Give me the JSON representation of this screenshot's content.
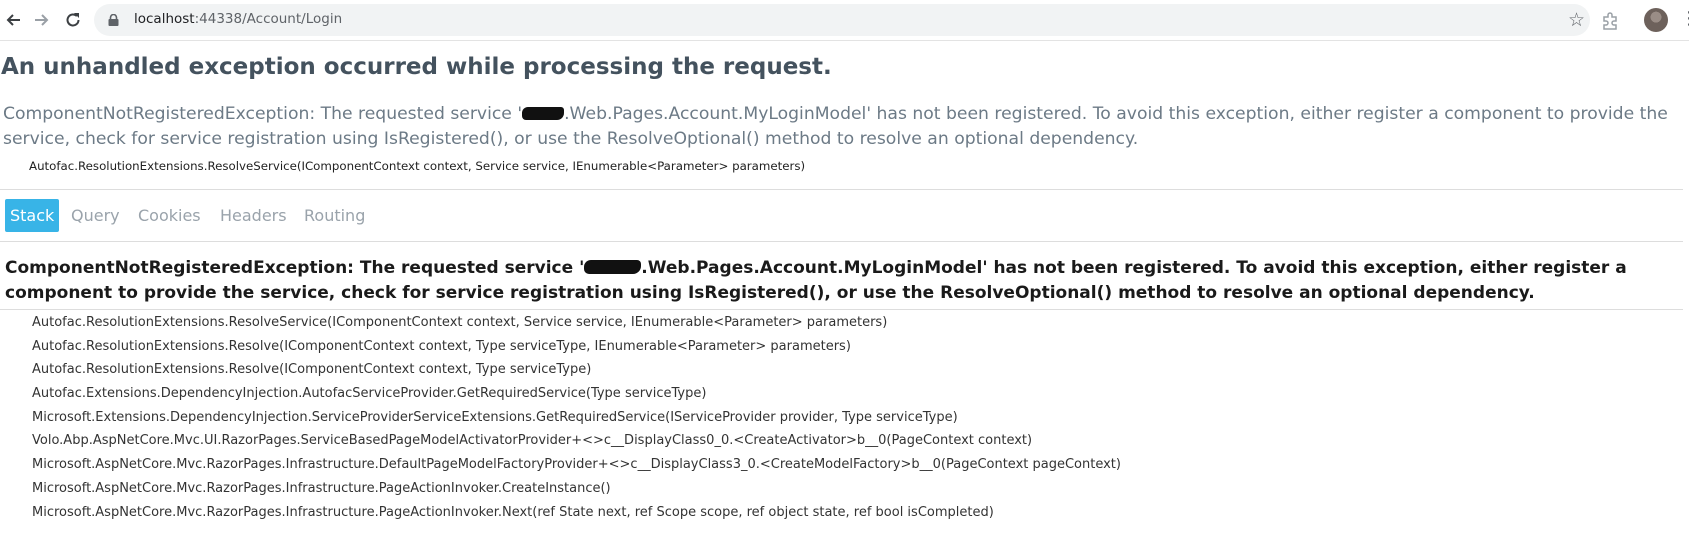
{
  "browser": {
    "url_host": "localhost",
    "url_rest": ":44338/Account/Login",
    "back_icon": "arrow-left-icon",
    "forward_icon": "arrow-right-icon",
    "reload_icon": "reload-icon",
    "star_icon": "star-icon"
  },
  "error": {
    "title": "An unhandled exception occurred while processing the request.",
    "summary_before": "ComponentNotRegisteredException: The requested service '",
    "summary_after": ".Web.Pages.Account.MyLoginModel' has not been registered. To avoid this exception, either register a component to provide the service, check for service registration using IsRegistered(), or use the ResolveOptional() method to resolve an optional dependency.",
    "location": "Autofac.ResolutionExtensions.ResolveService(IComponentContext context, Service service, IEnumerable<Parameter> parameters)"
  },
  "tabs": [
    {
      "label": "Stack",
      "selected": true
    },
    {
      "label": "Query",
      "selected": false
    },
    {
      "label": "Cookies",
      "selected": false
    },
    {
      "label": "Headers",
      "selected": false
    },
    {
      "label": "Routing",
      "selected": false
    }
  ],
  "stack": {
    "heading_before": "ComponentNotRegisteredException: The requested service '",
    "heading_after": ".Web.Pages.Account.MyLoginModel' has not been registered. To avoid this exception, either register a component to provide the service, check for service registration using IsRegistered(), or use the ResolveOptional() method to resolve an optional dependency.",
    "frames": [
      "Autofac.ResolutionExtensions.ResolveService(IComponentContext context, Service service, IEnumerable<Parameter> parameters)",
      "Autofac.ResolutionExtensions.Resolve(IComponentContext context, Type serviceType, IEnumerable<Parameter> parameters)",
      "Autofac.ResolutionExtensions.Resolve(IComponentContext context, Type serviceType)",
      "Autofac.Extensions.DependencyInjection.AutofacServiceProvider.GetRequiredService(Type serviceType)",
      "Microsoft.Extensions.DependencyInjection.ServiceProviderServiceExtensions.GetRequiredService(IServiceProvider provider, Type serviceType)",
      "Volo.Abp.AspNetCore.Mvc.UI.RazorPages.ServiceBasedPageModelActivatorProvider+<>c__DisplayClass0_0.<CreateActivator>b__0(PageContext context)",
      "Microsoft.AspNetCore.Mvc.RazorPages.Infrastructure.DefaultPageModelFactoryProvider+<>c__DisplayClass3_0.<CreateModelFactory>b__0(PageContext pageContext)",
      "Microsoft.AspNetCore.Mvc.RazorPages.Infrastructure.PageActionInvoker.CreateInstance()",
      "Microsoft.AspNetCore.Mvc.RazorPages.Infrastructure.PageActionInvoker.Next(ref State next, ref Scope scope, ref object state, ref bool isCompleted)"
    ]
  },
  "colors": {
    "tab_selected_bg": "#38b4e7",
    "title": "#44525e",
    "summary": "#6c7a86"
  }
}
